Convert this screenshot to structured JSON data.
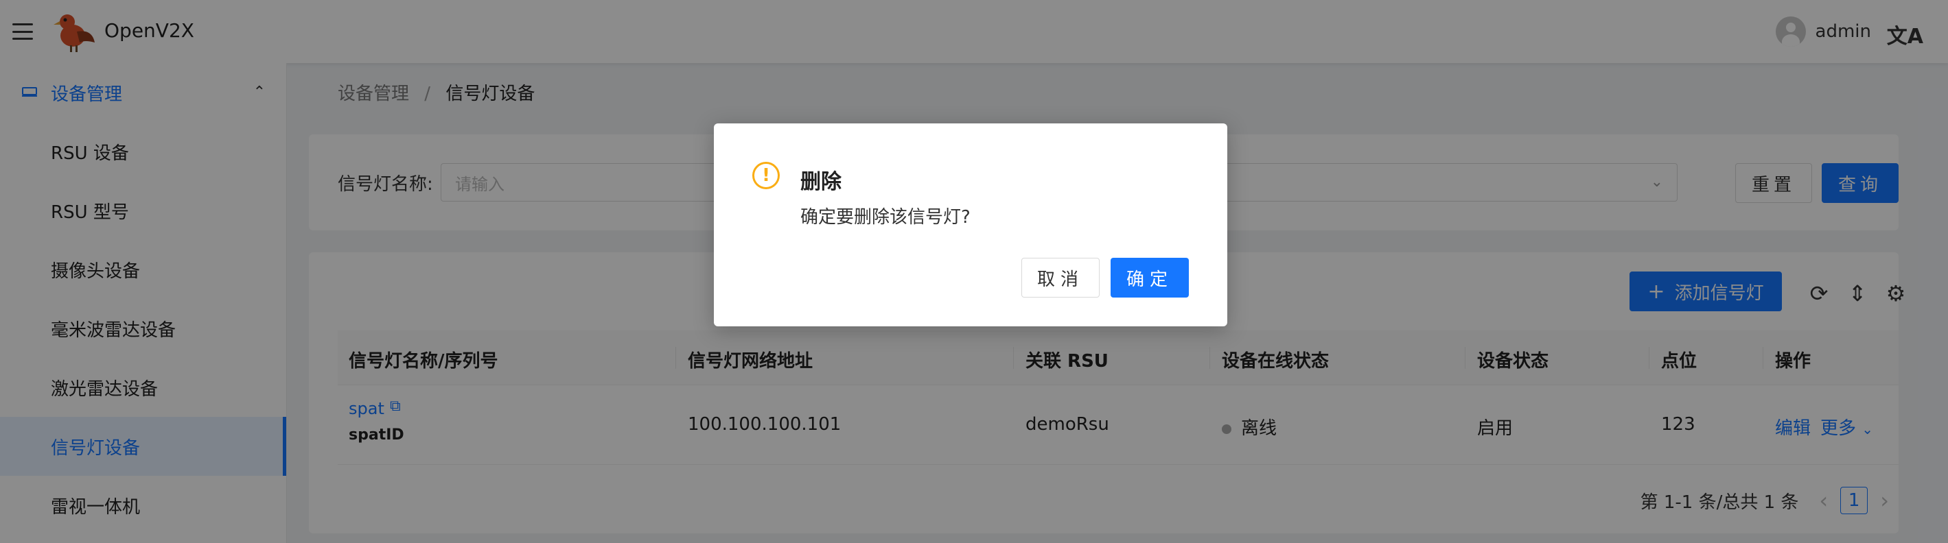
{
  "app": {
    "title": "OpenV2X"
  },
  "header": {
    "username": "admin",
    "lang_glyph": "文A"
  },
  "sidebar": {
    "group_label": "设备管理",
    "items": [
      {
        "label": "RSU 设备"
      },
      {
        "label": "RSU 型号"
      },
      {
        "label": "摄像头设备"
      },
      {
        "label": "毫米波雷达设备"
      },
      {
        "label": "激光雷达设备"
      },
      {
        "label": "信号灯设备"
      },
      {
        "label": "雷视一体机"
      }
    ],
    "active_index": 5
  },
  "breadcrumb": {
    "parent": "设备管理",
    "separator": "/",
    "current": "信号灯设备"
  },
  "filter": {
    "label": "信号灯名称:",
    "placeholder": "请输入",
    "reset_label": "重置",
    "search_label": "查询"
  },
  "toolbar": {
    "add_label": "添加信号灯"
  },
  "table": {
    "columns": [
      "信号灯名称/序列号",
      "信号灯网络地址",
      "关联 RSU",
      "设备在线状态",
      "设备状态",
      "点位",
      "操作"
    ],
    "rows": [
      {
        "name": "spat",
        "serial": "spatID",
        "ip": "100.100.100.101",
        "rsu": "demoRsu",
        "online_status": "离线",
        "device_status": "启用",
        "point": "123",
        "action_edit": "编辑",
        "action_more": "更多"
      }
    ]
  },
  "pagination": {
    "summary": "第 1-1 条/总共 1 条",
    "current_page": "1",
    "prev": "‹",
    "next": "›"
  },
  "modal": {
    "title": "删除",
    "content": "确定要删除该信号灯?",
    "cancel_label": "取消",
    "ok_label": "确定"
  },
  "colors": {
    "primary": "#1677ff",
    "warning": "#faad14",
    "mask": "rgba(0,0,0,0.45)"
  }
}
